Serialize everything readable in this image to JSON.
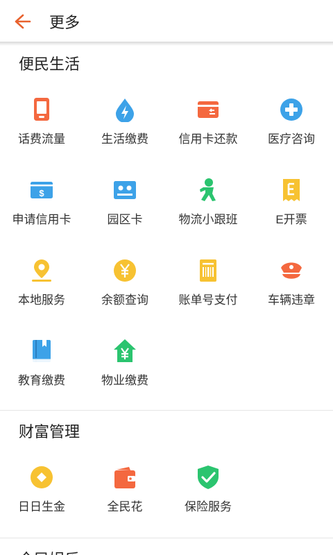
{
  "header": {
    "title": "更多"
  },
  "sections": [
    {
      "title": "便民生活",
      "items": [
        {
          "label": "话费流量",
          "icon": "phone-icon",
          "color": "#F4683F"
        },
        {
          "label": "生活缴费",
          "icon": "bolt-drop-icon",
          "color": "#3DA2E8"
        },
        {
          "label": "信用卡还款",
          "icon": "card-repay-icon",
          "color": "#F4683F"
        },
        {
          "label": "医疗咨询",
          "icon": "medical-cross-icon",
          "color": "#3DA2E8"
        },
        {
          "label": "申请信用卡",
          "icon": "credit-card-dollar-icon",
          "color": "#3DA2E8"
        },
        {
          "label": "园区卡",
          "icon": "park-card-icon",
          "color": "#3DA2E8"
        },
        {
          "label": "物流小跟班",
          "icon": "runner-icon",
          "color": "#2BC46F"
        },
        {
          "label": "E开票",
          "icon": "invoice-icon",
          "color": "#F7C232"
        },
        {
          "label": "本地服务",
          "icon": "location-pin-icon",
          "color": "#F7C232"
        },
        {
          "label": "余额查询",
          "icon": "yen-coin-icon",
          "color": "#F7C232"
        },
        {
          "label": "账单号支付",
          "icon": "barcode-bill-icon",
          "color": "#F7C232"
        },
        {
          "label": "车辆违章",
          "icon": "police-cap-icon",
          "color": "#F4683F"
        },
        {
          "label": "教育缴费",
          "icon": "book-icon",
          "color": "#3DA2E8"
        },
        {
          "label": "物业缴费",
          "icon": "house-yen-icon",
          "color": "#2BC46F"
        }
      ]
    },
    {
      "title": "财富管理",
      "items": [
        {
          "label": "日日生金",
          "icon": "gold-coin-icon",
          "color": "#F7C232"
        },
        {
          "label": "全民花",
          "icon": "wallet-icon",
          "color": "#F4683F"
        },
        {
          "label": "保险服务",
          "icon": "shield-check-icon",
          "color": "#2BC46F"
        }
      ]
    },
    {
      "title": "全民娱乐",
      "items": []
    }
  ]
}
